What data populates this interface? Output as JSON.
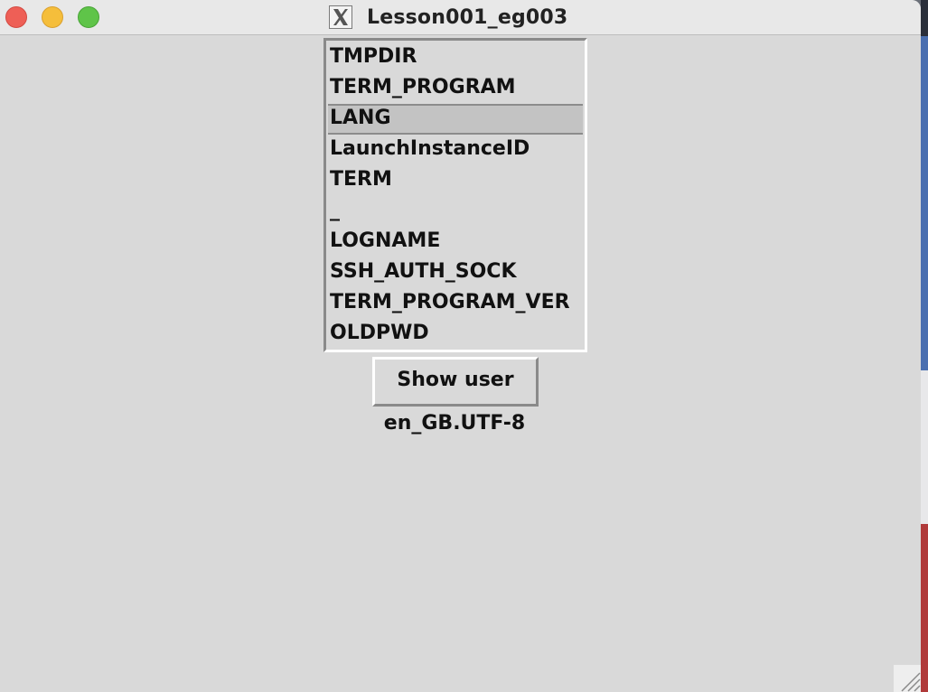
{
  "window": {
    "title": "Lesson001_eg003"
  },
  "listbox": {
    "items": [
      "TMPDIR",
      "TERM_PROGRAM",
      "LANG",
      "LaunchInstanceID",
      "TERM",
      "_",
      "LOGNAME",
      "SSH_AUTH_SOCK",
      "TERM_PROGRAM_VER",
      "OLDPWD"
    ],
    "selected": "LANG"
  },
  "button": {
    "label": "Show user"
  },
  "output": {
    "text": "en_GB.UTF-8"
  },
  "colors": {
    "window_bg": "#d9d9d9",
    "selection_bg": "#c3c3c3",
    "close": "#ee5f56",
    "minimize": "#f5be3b",
    "maximize": "#5fc449"
  }
}
